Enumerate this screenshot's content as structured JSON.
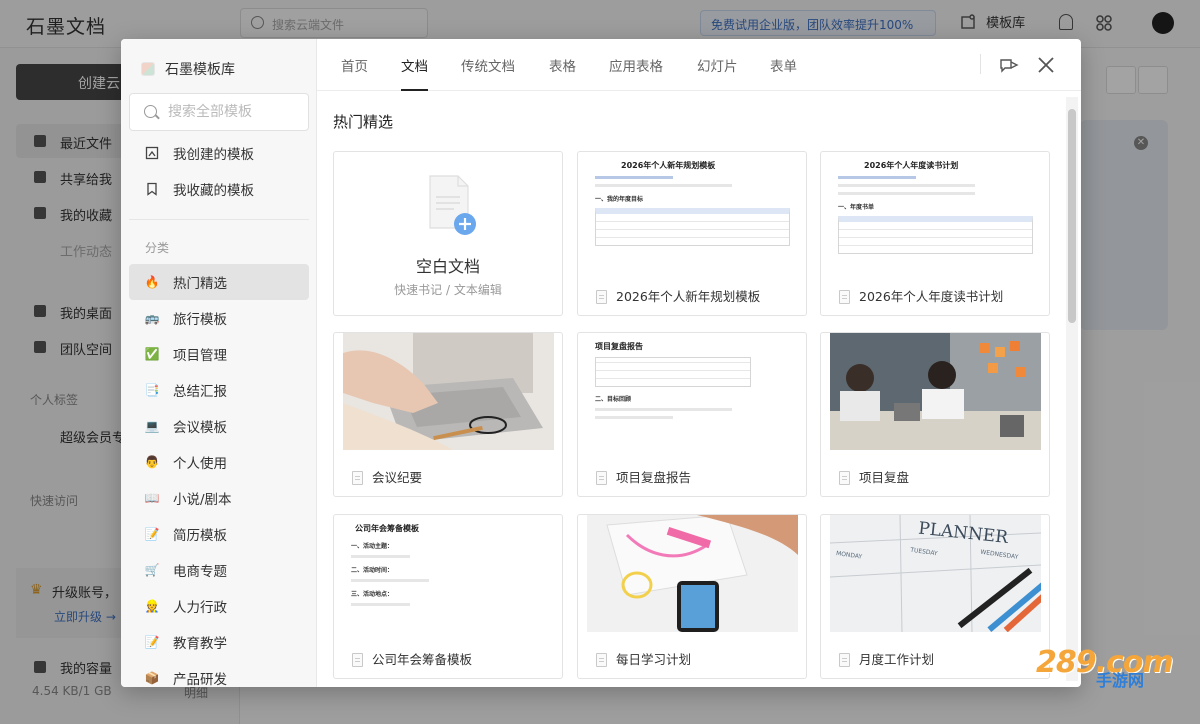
{
  "app": {
    "logo": "石墨文档",
    "search_placeholder": "搜索云端文件",
    "promo": "免费试用企业版，团队效率提升100%",
    "template_library": "模板库",
    "create_button": "创建云",
    "nav": [
      {
        "label": "最近文件"
      },
      {
        "label": "共享给我"
      },
      {
        "label": "我的收藏"
      },
      {
        "label": "工作动态"
      },
      {
        "label": "我的桌面"
      },
      {
        "label": "团队空间"
      }
    ],
    "section_personal_tags": "个人标签",
    "super_member": "超级会员专",
    "section_quick_access": "快速访问",
    "upgrade_text": "升级账号，",
    "upgrade_link": "立即升级 →",
    "capacity_label": "我的容量",
    "capacity_value": "4.54 KB/1 GB",
    "capacity_detail": "明细"
  },
  "dialog": {
    "brand": "石墨模板库",
    "search_placeholder": "搜索全部模板",
    "top_items": [
      {
        "label": "我创建的模板",
        "icon": "created-template-icon"
      },
      {
        "label": "我收藏的模板",
        "icon": "bookmark-icon"
      }
    ],
    "category_title": "分类",
    "categories": [
      {
        "label": "热门精选",
        "icon": "fire-icon",
        "emoji": "🔥"
      },
      {
        "label": "旅行模板",
        "icon": "car-icon",
        "emoji": "🚌"
      },
      {
        "label": "项目管理",
        "icon": "checkbox-icon",
        "emoji": "✅"
      },
      {
        "label": "总结汇报",
        "icon": "report-icon",
        "emoji": "📑"
      },
      {
        "label": "会议模板",
        "icon": "laptop-icon",
        "emoji": "💻"
      },
      {
        "label": "个人使用",
        "icon": "person-icon",
        "emoji": "👨"
      },
      {
        "label": "小说/剧本",
        "icon": "book-icon",
        "emoji": "📖"
      },
      {
        "label": "简历模板",
        "icon": "memo-icon",
        "emoji": "📝"
      },
      {
        "label": "电商专题",
        "icon": "cart-icon",
        "emoji": "🛒"
      },
      {
        "label": "人力行政",
        "icon": "worker-icon",
        "emoji": "👷"
      },
      {
        "label": "教育教学",
        "icon": "pencil-icon",
        "emoji": "📝"
      },
      {
        "label": "产品研发",
        "icon": "product-icon",
        "emoji": "📦"
      }
    ],
    "tabs": [
      "首页",
      "文档",
      "传统文档",
      "表格",
      "应用表格",
      "幻灯片",
      "表单"
    ],
    "active_tab": "文档",
    "section_title": "热门精选",
    "blank_card": {
      "title": "空白文档",
      "subtitle": "快速书记 / 文本编辑"
    },
    "cards": [
      {
        "name": "2026年个人新年规划模板",
        "thumb_title": "2026年个人新年规划模板",
        "thumb_heading": "一、我的年度目标"
      },
      {
        "name": "2026年个人年度读书计划",
        "thumb_title": "2026年个人年度读书计划",
        "thumb_heading": "一、年度书单"
      },
      {
        "name": "会议纪要"
      },
      {
        "name": "项目复盘报告",
        "thumb_title": "项目复盘报告",
        "thumb_heading": "二、目标回顾"
      },
      {
        "name": "项目复盘"
      },
      {
        "name": "公司年会筹备模板",
        "thumb_title": "公司年会筹备模板",
        "thumb_lines": [
          "一、活动主题：",
          "二、活动时间：",
          "三、活动地点："
        ]
      },
      {
        "name": "每日学习计划"
      },
      {
        "name": "月度工作计划",
        "thumb_title": "PLANNER",
        "days": [
          "MONDAY",
          "TUESDAY",
          "WEDNESDAY"
        ]
      }
    ]
  },
  "watermark": {
    "number": "289.com",
    "text": "手游网"
  }
}
